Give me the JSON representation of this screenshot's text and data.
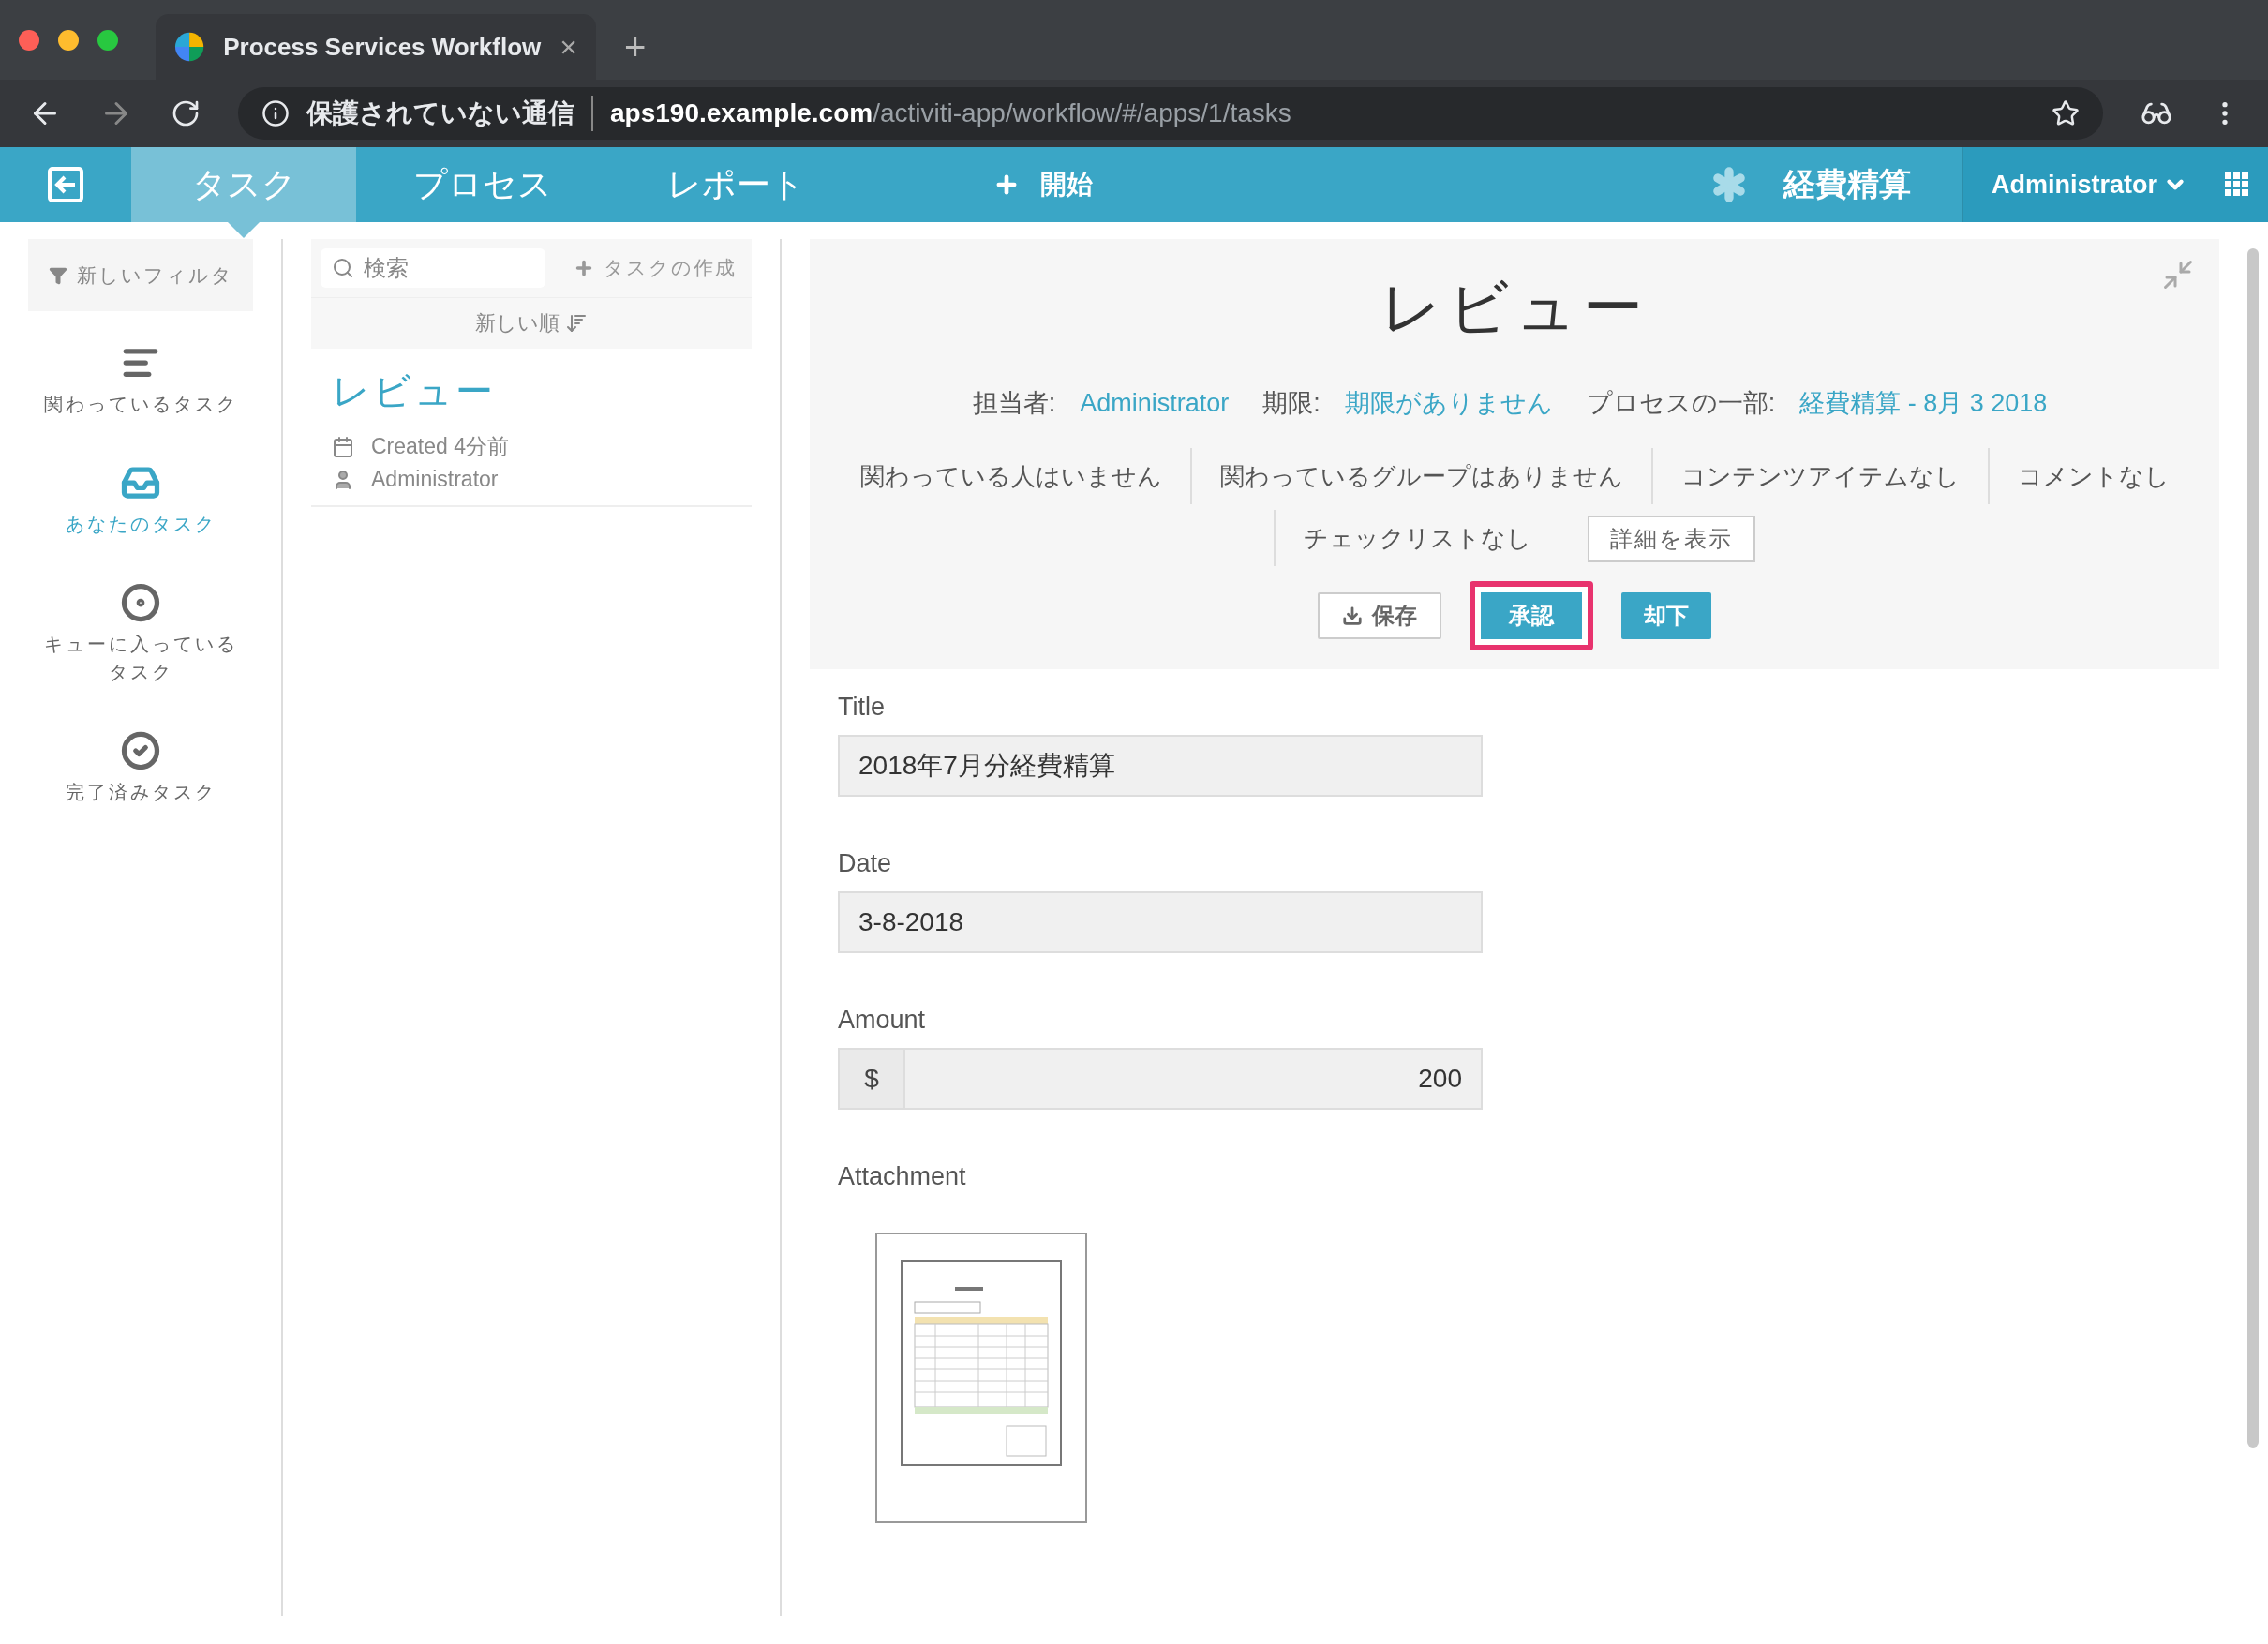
{
  "browser": {
    "tab_title": "Process Services Workflow",
    "tab_close": "×",
    "new_tab": "+",
    "security": "保護されていない通信",
    "url_host": "aps190.example.com",
    "url_path": "/activiti-app/workflow/#/apps/1/tasks"
  },
  "header": {
    "nav": [
      {
        "label": "タスク",
        "selected": true
      },
      {
        "label": "プロセス",
        "selected": false
      },
      {
        "label": "レポート",
        "selected": false
      }
    ],
    "start": "開始",
    "app_name": "経費精算",
    "user": "Administrator"
  },
  "sidebar": {
    "filter": "新しいフィルタ",
    "items": [
      {
        "label": "関わっているタスク",
        "kind": "involved",
        "selected": false
      },
      {
        "label": "あなたのタスク",
        "kind": "mine",
        "selected": true
      },
      {
        "label": "キューに入っているタスク",
        "kind": "queued",
        "selected": false
      },
      {
        "label": "完了済みタスク",
        "kind": "completed",
        "selected": false
      }
    ]
  },
  "task_list": {
    "search_placeholder": "検索",
    "create": "タスクの作成",
    "sort": "新しい順",
    "tasks": [
      {
        "title": "レビュー",
        "created": "Created 4分前",
        "assignee": "Administrator"
      }
    ]
  },
  "detail": {
    "title": "レビュー",
    "meta": [
      {
        "label": "担当者:",
        "value": "Administrator"
      },
      {
        "label": "期限:",
        "value": "期限がありません"
      },
      {
        "label": "プロセスの一部:",
        "value": "経費精算 - 8月 3 2018"
      }
    ],
    "stats": [
      "関わっている人はいません",
      "関わっているグループはありません",
      "コンテンツアイテムなし",
      "コメントなし",
      "チェックリストなし"
    ],
    "details_button": "詳細を表示",
    "actions": [
      {
        "label": "保存",
        "kind": "save",
        "highlighted": false
      },
      {
        "label": "承認",
        "kind": "primary",
        "highlighted": true
      },
      {
        "label": "却下",
        "kind": "primary",
        "highlighted": false
      }
    ]
  },
  "form": {
    "fields": [
      {
        "label": "Title",
        "value": "2018年7月分経費精算",
        "kind": "text"
      },
      {
        "label": "Date",
        "value": "3-8-2018",
        "kind": "text"
      },
      {
        "label": "Amount",
        "value": "200",
        "kind": "amount",
        "prefix": "$"
      }
    ],
    "attachment_label": "Attachment"
  }
}
